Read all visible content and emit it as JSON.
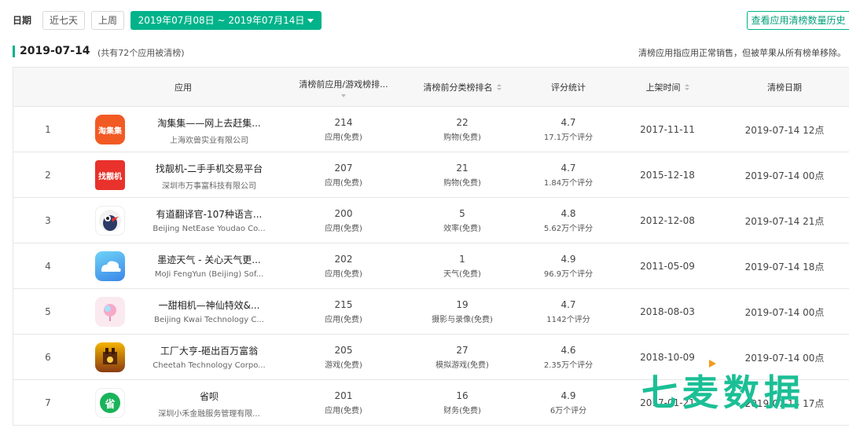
{
  "colors": {
    "accent": "#00b38a",
    "watermark": "#1bbf96",
    "watermark_dot": "#f39a1e"
  },
  "toolbar": {
    "date_label": "日期",
    "btn_last7": "近七天",
    "btn_lastweek": "上周",
    "range_label": "2019年07月08日 ~ 2019年07月14日",
    "history_button": "查看应用清榜数量历史"
  },
  "section": {
    "date": "2019-07-14",
    "count": "(共有72个应用被清榜)",
    "note": "清榜应用指应用正常销售，但被苹果从所有榜单移除。"
  },
  "table": {
    "headers": {
      "app": "应用",
      "pre_rank": "清榜前应用/游戏榜排...",
      "cat_rank": "清榜前分类榜排名",
      "rating": "评分统计",
      "publish": "上架时间",
      "clear": "清榜日期"
    },
    "rows": [
      {
        "rank": "1",
        "icon": "taojiji-icon",
        "name": "淘集集——网上去赶集...",
        "dev": "上海欢兽实业有限公司",
        "pre_rank": "214",
        "pre_type": "应用(免费)",
        "cat_rank": "22",
        "cat_type": "购物(免费)",
        "rating": "4.7",
        "rating_count": "17.1万个评分",
        "publish": "2017-11-11",
        "clear": "2019-07-14 12点"
      },
      {
        "rank": "2",
        "icon": "zhaoliangji-icon",
        "name": "找靓机-二手手机交易平台",
        "dev": "深圳市万事富科技有限公司",
        "pre_rank": "207",
        "pre_type": "应用(免费)",
        "cat_rank": "21",
        "cat_type": "购物(免费)",
        "rating": "4.7",
        "rating_count": "1.84万个评分",
        "publish": "2015-12-18",
        "clear": "2019-07-14 00点"
      },
      {
        "rank": "3",
        "icon": "youdao-translate-icon",
        "name": "有道翻译官-107种语言...",
        "dev": "Beijing NetEase Youdao Co...",
        "pre_rank": "200",
        "pre_type": "应用(免费)",
        "cat_rank": "5",
        "cat_type": "效率(免费)",
        "rating": "4.8",
        "rating_count": "5.62万个评分",
        "publish": "2012-12-08",
        "clear": "2019-07-14 21点"
      },
      {
        "rank": "4",
        "icon": "moji-weather-icon",
        "name": "墨迹天气 - 关心天气更...",
        "dev": "MoJi FengYun (Beijing) Sof...",
        "pre_rank": "202",
        "pre_type": "应用(免费)",
        "cat_rank": "1",
        "cat_type": "天气(免费)",
        "rating": "4.9",
        "rating_count": "96.9万个评分",
        "publish": "2011-05-09",
        "clear": "2019-07-14 18点"
      },
      {
        "rank": "5",
        "icon": "yitian-camera-icon",
        "name": "一甜相机—神仙特效&...",
        "dev": "Beijing Kwai Technology C...",
        "pre_rank": "215",
        "pre_type": "应用(免费)",
        "cat_rank": "19",
        "cat_type": "摄影与录像(免费)",
        "rating": "4.7",
        "rating_count": "1142个评分",
        "publish": "2018-08-03",
        "clear": "2019-07-14 00点"
      },
      {
        "rank": "6",
        "icon": "factory-tycoon-icon",
        "name": "工厂大亨-砸出百万富翁",
        "dev": "Cheetah Technology Corpo...",
        "pre_rank": "205",
        "pre_type": "游戏(免费)",
        "cat_rank": "27",
        "cat_type": "模拟游戏(免费)",
        "rating": "4.6",
        "rating_count": "2.35万个评分",
        "publish": "2018-10-09",
        "clear": "2019-07-14 00点"
      },
      {
        "rank": "7",
        "icon": "shengbei-icon",
        "name": "省呗",
        "dev": "深圳小禾金融服务管理有限...",
        "pre_rank": "201",
        "pre_type": "应用(免费)",
        "cat_rank": "16",
        "cat_type": "财务(免费)",
        "rating": "4.9",
        "rating_count": "6万个评分",
        "publish": "2017-01-21",
        "clear": "2019-07-14 17点"
      }
    ]
  },
  "icon_labels": {
    "taojiji": "淘集集",
    "zhaoliangji": "找靓机",
    "shengbei": "省"
  },
  "watermark": {
    "text": "七麦数据"
  }
}
